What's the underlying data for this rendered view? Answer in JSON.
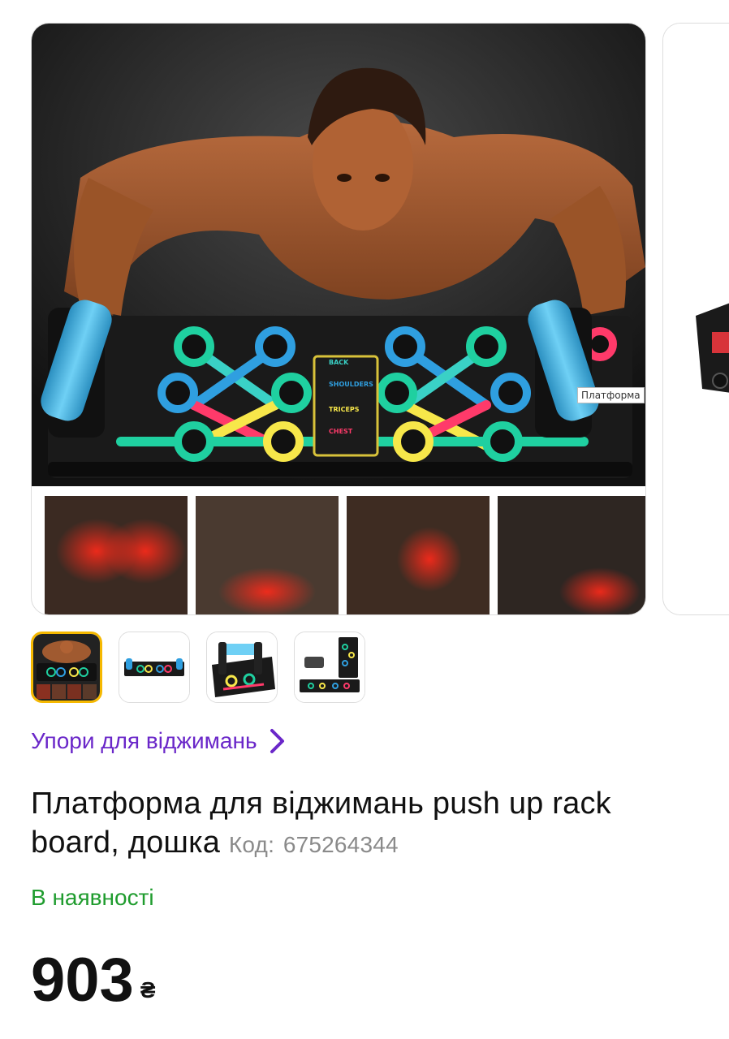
{
  "gallery": {
    "main_image_alt": "Платформа для віджимань push up rack board",
    "image_caption": "Платформа",
    "board_labels": [
      "BACK",
      "SHOULDERS",
      "TRICEPS",
      "CHEST"
    ],
    "thumbnails": [
      {
        "name": "thumb-1",
        "active": true
      },
      {
        "name": "thumb-2",
        "active": false
      },
      {
        "name": "thumb-3",
        "active": false
      },
      {
        "name": "thumb-4",
        "active": false
      }
    ]
  },
  "category": {
    "label": "Упори для віджимань"
  },
  "product": {
    "title": "Платформа для віджимань push up rack board, дошка",
    "code_label": "Код:",
    "code_value": "675264344",
    "availability": "В наявності",
    "price": "903",
    "currency": "₴"
  },
  "colors": {
    "accent": "#6a27c9",
    "in_stock": "#1f9c2e",
    "active_thumb_border": "#f5b800"
  }
}
